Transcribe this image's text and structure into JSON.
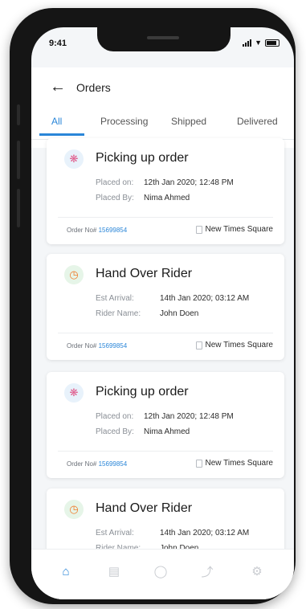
{
  "status_bar": {
    "time": "9:41"
  },
  "header": {
    "title": "Orders",
    "back_icon": "back-arrow-icon"
  },
  "tabs": [
    {
      "label": "All",
      "active": true
    },
    {
      "label": "Processing",
      "active": false
    },
    {
      "label": "Shipped",
      "active": false
    },
    {
      "label": "Delivered",
      "active": false
    }
  ],
  "orders": [
    {
      "icon": "loader-icon",
      "title": "Picking up order",
      "rows": [
        {
          "label": "Placed on:",
          "value": "12th Jan 2020; 12:48 PM"
        },
        {
          "label": "Placed By:",
          "value": "Nima Ahmed"
        }
      ],
      "order_label": "Order No#",
      "order_no": "15699854",
      "store": "New Times Square"
    },
    {
      "icon": "timer-icon",
      "title": "Hand Over Rider",
      "rows": [
        {
          "label": "Est Arrival:",
          "value": "14th Jan 2020; 03:12 AM"
        },
        {
          "label": "Rider Name:",
          "value": "John Doen"
        }
      ],
      "order_label": "Order No#",
      "order_no": "15699854",
      "store": "New Times Square"
    },
    {
      "icon": "loader-icon",
      "title": "Picking up order",
      "rows": [
        {
          "label": "Placed on:",
          "value": "12th Jan 2020; 12:48 PM"
        },
        {
          "label": "Placed By:",
          "value": "Nima Ahmed"
        }
      ],
      "order_label": "Order No#",
      "order_no": "15699854",
      "store": "New Times Square"
    },
    {
      "icon": "timer-icon",
      "title": "Hand Over Rider",
      "rows": [
        {
          "label": "Est Arrival:",
          "value": "14th Jan 2020; 03:12 AM"
        },
        {
          "label": "Rider Name:",
          "value": "John Doen"
        }
      ]
    }
  ],
  "bottom_nav": [
    {
      "icon": "home-icon",
      "active": true
    },
    {
      "icon": "clipboard-icon",
      "active": false
    },
    {
      "icon": "chat-icon",
      "active": false
    },
    {
      "icon": "route-icon",
      "active": false
    },
    {
      "icon": "gear-icon",
      "active": false
    }
  ],
  "colors": {
    "accent": "#2a86d8",
    "loader": "#e05a8a",
    "timer": "#f07a2a"
  }
}
